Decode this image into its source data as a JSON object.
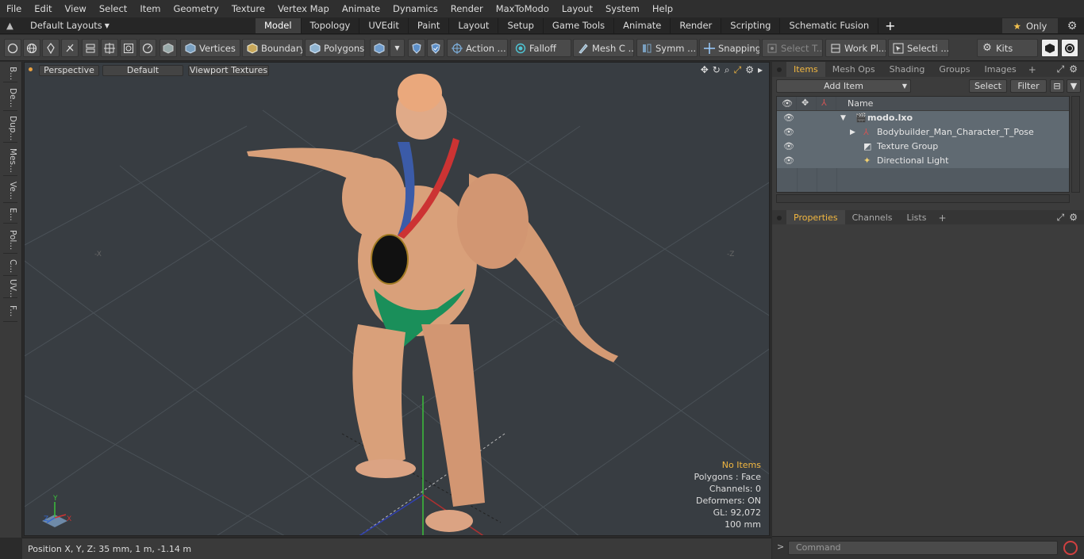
{
  "menu": [
    "File",
    "Edit",
    "View",
    "Select",
    "Item",
    "Geometry",
    "Texture",
    "Vertex Map",
    "Animate",
    "Dynamics",
    "Render",
    "MaxToModo",
    "Layout",
    "System",
    "Help"
  ],
  "layouts_label": "Default Layouts",
  "layout_tabs": [
    "Model",
    "Topology",
    "UVEdit",
    "Paint",
    "Layout",
    "Setup",
    "Game Tools",
    "Animate",
    "Render",
    "Scripting",
    "Schematic Fusion"
  ],
  "active_layout_tab": "Model",
  "only_label": "Only",
  "toolbar": {
    "vertices": "Vertices",
    "boundary": "Boundary",
    "polygons": "Polygons",
    "action": "Action ...",
    "falloff": "Falloff",
    "meshc": "Mesh C ...",
    "symm": "Symm ...",
    "snapping": "Snapping",
    "select_t": "Select T...",
    "workpl": "Work Pl...",
    "selecti": "Selecti ...",
    "kits": "Kits"
  },
  "side_tabs": [
    "B...",
    "De...",
    "Dup...",
    "Mes...",
    "Ve...",
    "E...",
    "Pol...",
    "C...",
    "UV...",
    "F..."
  ],
  "viewport": {
    "perspective": "Perspective",
    "default": "Default",
    "textures": "Viewport Textures",
    "stats": {
      "no_items": "No Items",
      "polygons": "Polygons : Face",
      "channels": "Channels: 0",
      "deformers": "Deformers: ON",
      "gl": "GL: 92,072",
      "scale": "100 mm"
    },
    "axis_labels": {
      "x": "X",
      "y": "Y",
      "z": "Z"
    }
  },
  "status": {
    "position": "Position X, Y, Z:  35 mm, 1 m, -1.14 m"
  },
  "items_panel": {
    "tabs": [
      "Items",
      "Mesh Ops",
      "Shading",
      "Groups",
      "Images"
    ],
    "active_tab": "Items",
    "add_item": "Add Item",
    "select": "Select",
    "filter": "Filter",
    "column_name": "Name",
    "rows": [
      {
        "name": "modo.lxo",
        "bold": true
      },
      {
        "name": "Bodybuilder_Man_Character_T_Pose",
        "bold": false
      },
      {
        "name": "Texture Group",
        "bold": false
      },
      {
        "name": "Directional Light",
        "bold": false
      }
    ]
  },
  "props_panel": {
    "tabs": [
      "Properties",
      "Channels",
      "Lists"
    ],
    "active_tab": "Properties"
  },
  "command": {
    "placeholder": "Command"
  },
  "colors": {
    "accent": "#f2b740",
    "viewport_bg": "#383d42"
  }
}
